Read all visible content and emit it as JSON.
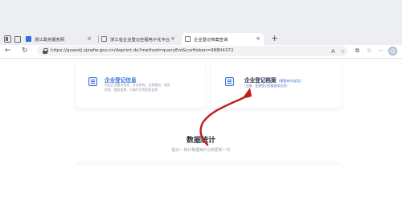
{
  "browser": {
    "tabs": [
      {
        "label": "浙江政务服务网"
      },
      {
        "label": "浙江省企业登记全程电子化平台"
      },
      {
        "label": "企业登记档案查询"
      }
    ],
    "new_tab_glyph": "+",
    "close_glyph": "×",
    "url": "https://gswsdj.zjzwfw.gov.cn/daprint.do?method=queryEnt&csrftoken=98804372",
    "nav_glyphs": {
      "back": "←",
      "reload": "↻"
    },
    "toolbar_glyphs": {
      "reader": "A",
      "favorite": "☆",
      "split": "⧉",
      "collections": "☆",
      "more": "⋯"
    }
  },
  "cards": [
    {
      "title": "企业登记信息",
      "desc_lines": [
        "包括企业基本信息、分支机构、出资情况、成员",
        "信息、股权变更、行政许可等相关信息"
      ],
      "icon": "document-icon"
    },
    {
      "title": "企业登记档案",
      "subtitle": "(需要有外部证)",
      "desc_lines": [
        "(注册、变更登记档案调用信息)"
      ],
      "icon": "document-icon"
    }
  ],
  "stats": {
    "title": "数据统计",
    "subtitle": "提示：统计数据每5分钟更新一次"
  },
  "colors": {
    "accent": "#2f6fdb",
    "arrow": "#c21c1c",
    "tabstrip": "#eceef1"
  }
}
